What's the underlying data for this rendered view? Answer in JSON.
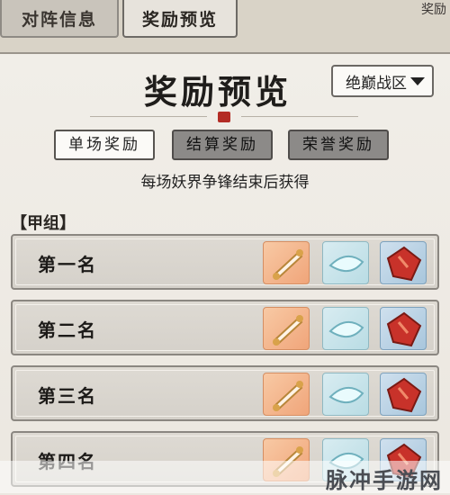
{
  "tabs": [
    {
      "label": "对阵信息"
    },
    {
      "label": "奖励预览"
    }
  ],
  "corner_text": "奖励",
  "panel": {
    "title": "奖励预览",
    "region_select": "绝巅战区",
    "buttons": [
      {
        "label": "单场奖励",
        "active": true
      },
      {
        "label": "结算奖励",
        "active": false
      },
      {
        "label": "荣誉奖励",
        "active": false
      }
    ],
    "subtitle": "每场妖界争锋结束后获得",
    "group_label": "【甲组】",
    "rows": [
      {
        "rank": "第一名"
      },
      {
        "rank": "第二名"
      },
      {
        "rank": "第三名"
      },
      {
        "rank": "第四名"
      }
    ]
  },
  "watermark": "脉冲手游网",
  "colors": {
    "seal": "#b32c25",
    "active_button": "#fbfaf7",
    "inactive_button": "#8c8a88"
  }
}
